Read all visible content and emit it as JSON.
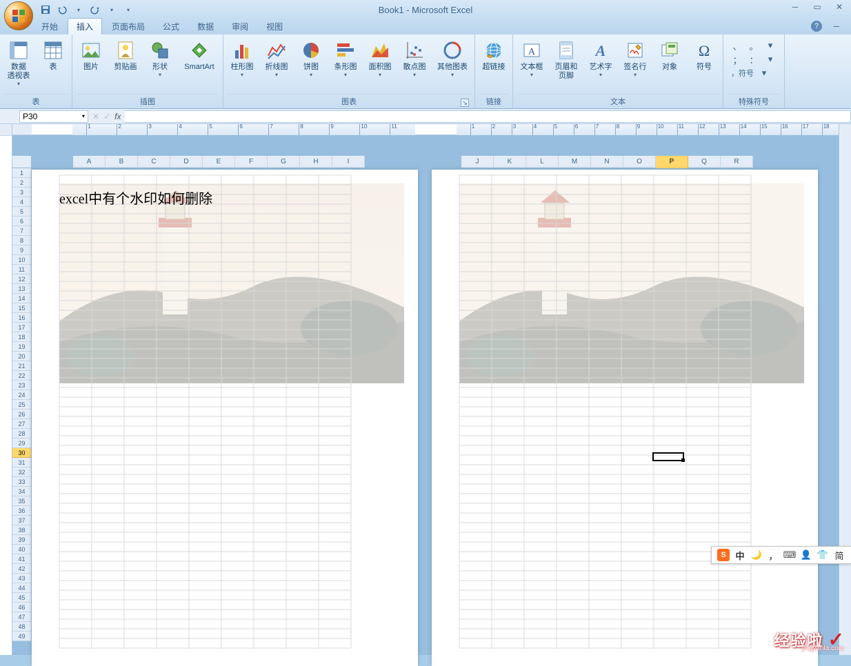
{
  "title": "Book1 - Microsoft Excel",
  "tabs": {
    "start": "开始",
    "insert": "插入",
    "pageLayout": "页面布局",
    "formulas": "公式",
    "data": "数据",
    "review": "审阅",
    "view": "视图"
  },
  "ribbon": {
    "tables": {
      "pivot": "数据\n透视表",
      "table": "表",
      "group": "表"
    },
    "illustrations": {
      "picture": "图片",
      "clipart": "剪贴画",
      "shapes": "形状",
      "smartart": "SmartArt",
      "group": "插图"
    },
    "charts": {
      "column": "柱形图",
      "line": "折线图",
      "pie": "饼图",
      "bar": "条形图",
      "area": "面积图",
      "scatter": "散点图",
      "other": "其他图表",
      "group": "图表"
    },
    "links": {
      "hyperlink": "超链接",
      "group": "链接"
    },
    "text": {
      "textbox": "文本框",
      "headerfooter": "页眉和\n页脚",
      "wordart": "艺术字",
      "signature": "签名行",
      "object": "对象",
      "symbol": "符号",
      "group": "文本"
    },
    "special": {
      "label": "，符号",
      "group": "特殊符号"
    }
  },
  "namebox": "P30",
  "fx": "fx",
  "columns1": [
    "A",
    "B",
    "C",
    "D",
    "E",
    "F",
    "G",
    "H",
    "I"
  ],
  "columns2": [
    "J",
    "K",
    "L",
    "M",
    "N",
    "O",
    "P",
    "Q",
    "R"
  ],
  "rows": [
    "1",
    "2",
    "3",
    "4",
    "5",
    "6",
    "7",
    "8",
    "9",
    "10",
    "11",
    "12",
    "13",
    "14",
    "15",
    "16",
    "17",
    "18",
    "19",
    "20",
    "21",
    "22",
    "23",
    "24",
    "25",
    "26",
    "27",
    "28",
    "29",
    "30",
    "31",
    "32",
    "33",
    "34",
    "35",
    "36",
    "37",
    "38",
    "39",
    "40",
    "41",
    "42",
    "43",
    "44",
    "45",
    "46",
    "47",
    "48",
    "49"
  ],
  "selectedRow": "30",
  "selectedCol": "P",
  "cellText": "excel中有个水印如何删除",
  "ruler1": [
    "1",
    "2",
    "3",
    "4",
    "5",
    "6",
    "7",
    "8",
    "9",
    "10",
    "11"
  ],
  "ruler2": [
    "1",
    "2",
    "3",
    "4",
    "5",
    "6",
    "7",
    "8",
    "9",
    "10",
    "11",
    "12",
    "13",
    "14",
    "15",
    "16",
    "17",
    "18"
  ],
  "ime": {
    "cn": "中",
    "shirt": "👕",
    "abbr": "简"
  },
  "siteMark": {
    "text": "经验啦",
    "url": "jingyanla.com"
  }
}
